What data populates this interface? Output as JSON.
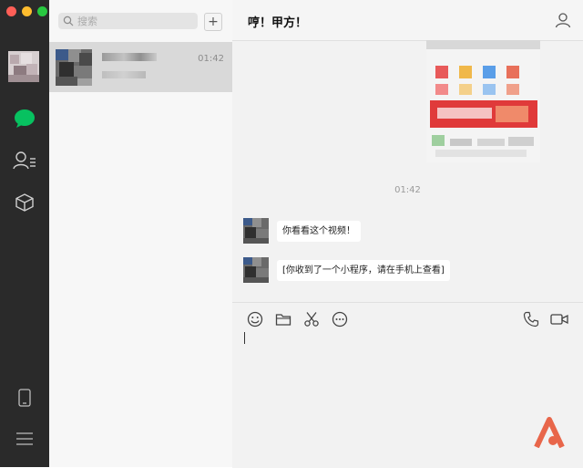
{
  "window": {
    "traffic_lights": [
      "#ff5f57",
      "#febc2e",
      "#28c840"
    ]
  },
  "rail": {
    "items": [
      {
        "name": "chats",
        "icon": "chat-bubble-icon",
        "color": "#07c160"
      },
      {
        "name": "contacts",
        "icon": "contacts-icon"
      },
      {
        "name": "favorites",
        "icon": "box-icon"
      }
    ],
    "bottom": [
      {
        "name": "phone",
        "icon": "phone-icon"
      },
      {
        "name": "menu",
        "icon": "menu-icon"
      }
    ]
  },
  "search": {
    "placeholder": "搜索",
    "add_label": "+"
  },
  "conversations": [
    {
      "time": "01:42"
    }
  ],
  "chat": {
    "title": "哼！甲方！",
    "time_divider": "01:42",
    "messages": [
      {
        "text": "你看看这个视频！"
      },
      {
        "text": "[你收到了一个小程序，请在手机上查看]"
      }
    ]
  },
  "composer": {
    "tools": [
      "emoji-icon",
      "folder-icon",
      "scissors-icon",
      "chat-dots-icon"
    ],
    "right_tools": [
      "phone-call-icon",
      "video-call-icon"
    ]
  },
  "colors": {
    "accent": "#07c160",
    "logo": "#e8664a"
  }
}
